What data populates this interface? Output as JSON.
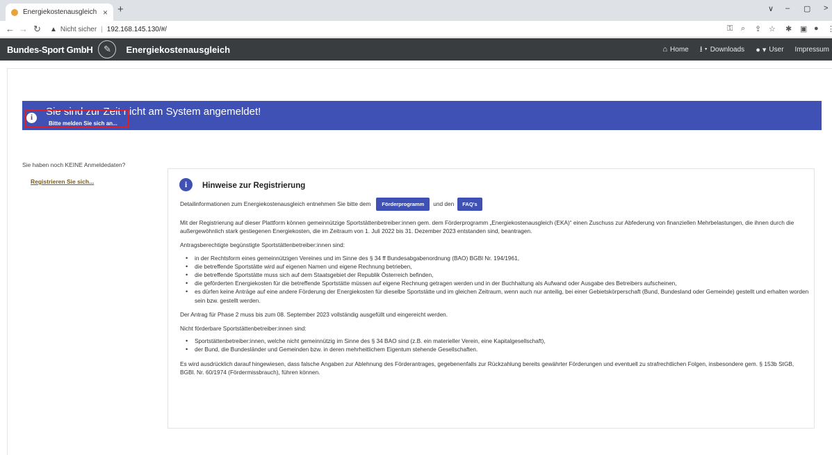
{
  "browser": {
    "tab_title": "Energiekostenausgleich",
    "tab_close": "×",
    "new_tab": "+",
    "security_label": "Nicht sicher",
    "url": "192.168.145.130/#/",
    "window_controls": [
      "∨",
      "–",
      "▢",
      ">"
    ]
  },
  "navbar": {
    "brand": "Bundes-Sport GmbH",
    "app_title": "Energiekostenausgleich",
    "links": {
      "home": "Home",
      "downloads": "Downloads",
      "user": "User",
      "impressum": "Impressum"
    }
  },
  "alert": {
    "title": "Sie sind zur Zeit nicht am System angemeldet!",
    "subtitle": "Bitte melden Sie sich an..."
  },
  "sidebar": {
    "no_credentials": "Sie haben noch KEINE Anmeldedaten?",
    "register_link": "Registrieren Sie sich..."
  },
  "panel": {
    "title": "Hinweise zur Registrierung",
    "intro_before": "Detailinformationen zum Energiekostenausgleich entnehmen Sie bitte dem",
    "button_program": "Förderprogramm",
    "intro_between": "und den",
    "button_faq": "FAQ's",
    "para1": "Mit der Registrierung auf dieser Plattform können gemeinnützige Sportstättenbetreiber:innen gem. dem Förderprogramm „Energiekostenausgleich (EKA)“ einen Zuschuss zur Abfederung von finanziellen Mehrbelastungen, die ihnen durch die außergewöhnlich stark gestiegenen Energiekosten, die im Zeitraum von 1. Juli 2022 bis 31. Dezember 2023 entstanden sind, beantragen.",
    "eligible_heading": "Antragsberechtigte begünstigte Sportstättenbetreiber:innen sind:",
    "eligible_items": [
      "in der Rechtsform eines gemeinnützigen Vereines und im Sinne des § 34 ff Bundesabgabenordnung (BAO) BGBl Nr. 194/1961,",
      "die betreffende Sportstätte wird auf eigenen Namen und eigene Rechnung betrieben,",
      "die betreffende Sportstätte muss sich auf dem Staatsgebiet der Republik Österreich befinden,",
      "die geförderten Energiekosten für die betreffende Sportstätte müssen auf eigene Rechnung getragen werden und in der Buchhaltung als Aufwand oder Ausgabe des Betreibers aufscheinen,",
      "es dürfen keine Anträge auf eine andere Förderung der Energiekosten für dieselbe Sportstätte und im gleichen Zeitraum, wenn auch nur anteilig, bei einer Gebietskörperschaft (Bund, Bundesland oder Gemeinde) gestellt und erhalten worden sein bzw. gestellt werden."
    ],
    "deadline": "Der Antrag für Phase 2 muss bis zum 08. September 2023 vollständig ausgefüllt und eingereicht werden.",
    "not_eligible_heading": "Nicht förderbare Sportstättenbetreiber:innen sind:",
    "not_eligible_items": [
      "Sportstättenbetreiber:innen, welche nicht gemeinnützig im Sinne des § 34 BAO sind (z.B. ein materieller Verein, eine Kapitalgesellschaft),",
      "der Bund, die Bundesländer und Gemeinden bzw. in deren mehrheitlichem Eigentum stehende Gesellschaften."
    ],
    "warning": "Es wird ausdrücklich darauf hingewiesen, dass falsche Angaben zur Ablehnung des Förderantrages, gegebenenfalls zur Rückzahlung bereits gewährter Förderungen und eventuell zu strafrechtlichen Folgen, insbesondere gem. § 153b StGB, BGBl. Nr. 60/1974 (Fördermissbrauch), führen können."
  },
  "colors": {
    "navbar_bg": "#3a3d40",
    "accent_blue": "#3f51b5",
    "highlight_red": "#e02020",
    "register_link": "#7a5c1e"
  }
}
